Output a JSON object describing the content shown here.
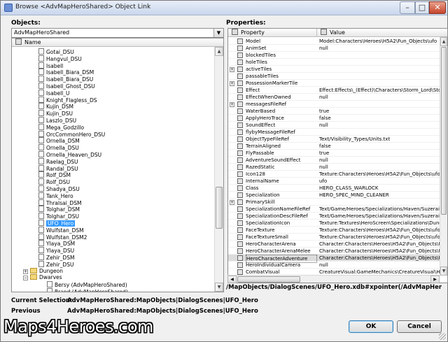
{
  "window": {
    "title": "Browse <AdvMapHeroShared> Object Link",
    "controls": {
      "minimize": "–",
      "maximize": "□",
      "close": "✕"
    }
  },
  "objects": {
    "label": "Objects:",
    "combo_value": "AdvMapHeroShared",
    "column_header": "Name",
    "items": [
      {
        "label": "Gotai_DSU",
        "type": "file"
      },
      {
        "label": "Hangvul_DSU",
        "type": "file"
      },
      {
        "label": "Isabell",
        "type": "file"
      },
      {
        "label": "Isabell_Biara_DSM",
        "type": "file"
      },
      {
        "label": "Isabell_Biara_DSU",
        "type": "file"
      },
      {
        "label": "Isabell_Ghost_DSU",
        "type": "file"
      },
      {
        "label": "Isabell_U",
        "type": "file"
      },
      {
        "label": "Knight_Flagless_DS",
        "type": "file"
      },
      {
        "label": "Kujin_DSM",
        "type": "file"
      },
      {
        "label": "Kujin_DSU",
        "type": "file"
      },
      {
        "label": "Laszlo_DSU",
        "type": "file"
      },
      {
        "label": "Mega_Godzillo",
        "type": "file"
      },
      {
        "label": "OrcCommonHero_DSU",
        "type": "file"
      },
      {
        "label": "Ornella_DSM",
        "type": "file"
      },
      {
        "label": "Ornella_DSU",
        "type": "file"
      },
      {
        "label": "Ornella_Heaven_DSU",
        "type": "file"
      },
      {
        "label": "Raelag_DSU",
        "type": "file"
      },
      {
        "label": "Randal_DSU",
        "type": "file"
      },
      {
        "label": "Rolf_DSM",
        "type": "file"
      },
      {
        "label": "Rolf_DSU",
        "type": "file"
      },
      {
        "label": "Shadya_DSU",
        "type": "file"
      },
      {
        "label": "Tank_Hero",
        "type": "file"
      },
      {
        "label": "Thralsai_DSM",
        "type": "file"
      },
      {
        "label": "Tolghar_DSM",
        "type": "file"
      },
      {
        "label": "Tolghar_DSU",
        "type": "file"
      },
      {
        "label": "UFO_Hero",
        "type": "file",
        "selected": true
      },
      {
        "label": "Wulfstan_DSM",
        "type": "file"
      },
      {
        "label": "Wulfstan_DSM2",
        "type": "file"
      },
      {
        "label": "Ylaya_DSM",
        "type": "file"
      },
      {
        "label": "Ylaya_DSU",
        "type": "file"
      },
      {
        "label": "Zehir_DSM",
        "type": "file"
      },
      {
        "label": "Zehir_DSU",
        "type": "file"
      },
      {
        "label": "Dungeon",
        "type": "folder",
        "expander": "+"
      },
      {
        "label": "Dwarves",
        "type": "folder",
        "expander": "−"
      },
      {
        "label": "Bersy (AdvMapHeroShared)",
        "type": "file"
      },
      {
        "label": "Brand (AdvMapHeroShared)",
        "type": "file"
      }
    ]
  },
  "properties": {
    "label": "Properties:",
    "col_property": "Property",
    "col_value": "Value",
    "rows": [
      {
        "name": "Model",
        "value": "Model:Characters\\Heroes\\H5A2\\Fun_Objects\\ufo",
        "exp": ""
      },
      {
        "name": "AnimSet",
        "value": "null",
        "exp": ""
      },
      {
        "name": "blockedTiles",
        "value": "",
        "exp": ""
      },
      {
        "name": "holeTiles",
        "value": "",
        "exp": ""
      },
      {
        "name": "activeTiles",
        "value": "",
        "exp": "+"
      },
      {
        "name": "passableTiles",
        "value": "",
        "exp": ""
      },
      {
        "name": "PossessionMarkerTile",
        "value": "",
        "exp": "+"
      },
      {
        "name": "Effect",
        "value": "Effect:Effects\\_(Effect)\\Characters\\Storm_Lord\\Storm_L",
        "exp": ""
      },
      {
        "name": "EffectWhenOwned",
        "value": "null",
        "exp": ""
      },
      {
        "name": "messagesFileRef",
        "value": "",
        "exp": "+"
      },
      {
        "name": "WaterBased",
        "value": "true",
        "exp": ""
      },
      {
        "name": "ApplyHeroTrace",
        "value": "false",
        "exp": ""
      },
      {
        "name": "SoundEffect",
        "value": "null",
        "exp": ""
      },
      {
        "name": "flybyMessageFileRef",
        "value": "",
        "exp": ""
      },
      {
        "name": "ObjectTypeFileRef",
        "value": "Text/Visibility_Types/Units.txt",
        "exp": ""
      },
      {
        "name": "TerrainAligned",
        "value": "false",
        "exp": ""
      },
      {
        "name": "FlyPassable",
        "value": "true",
        "exp": ""
      },
      {
        "name": "AdventureSoundEffect",
        "value": "null",
        "exp": ""
      },
      {
        "name": "RazedStatic",
        "value": "null",
        "exp": ""
      },
      {
        "name": "Icon128",
        "value": "Texture:Characters\\Heroes\\H5A2\\Fun_Objects\\ufo_ico",
        "exp": ""
      },
      {
        "name": "InternalName",
        "value": "ufo",
        "exp": ""
      },
      {
        "name": "Class",
        "value": "HERO_CLASS_WARLOCK",
        "exp": ""
      },
      {
        "name": "Specialization",
        "value": "HERO_SPEC_MIND_CLEANER",
        "exp": ""
      },
      {
        "name": "PrimarySkill",
        "value": "",
        "exp": "+"
      },
      {
        "name": "SpecializationNameFileRef",
        "value": "Text/Game/Heroes/Specializations/Haven/Suzerain/Na",
        "exp": ""
      },
      {
        "name": "SpecializationDescFileRef",
        "value": "Text/Game/Heroes/Specializations/Haven/Suzerain/De",
        "exp": ""
      },
      {
        "name": "SpecializationIcon",
        "value": "Texture:Textures\\HeroScreen\\Specializations\\Dungeon",
        "exp": ""
      },
      {
        "name": "FaceTexture",
        "value": "Texture:Characters\\Heroes\\H5A2\\Fun_Objects\\ufo_ico",
        "exp": ""
      },
      {
        "name": "FaceTextureSmall",
        "value": "Texture:Characters\\Heroes\\H5A2\\Fun_Objects\\ufo_ico",
        "exp": ""
      },
      {
        "name": "HeroCharacterArena",
        "value": "Character:Characters\\Heroes\\H5A2\\Fun_Objects\\UFO_",
        "exp": ""
      },
      {
        "name": "HeroCharacterArenaMelee",
        "value": "Character:Characters\\Heroes\\H5A2\\Fun_Objects\\UFO_",
        "exp": ""
      },
      {
        "name": "HeroCharacterAdventure",
        "value": "Character:Characters\\Heroes\\H5A2\\Fun_Objects\\UFO_",
        "exp": "",
        "selected": true
      },
      {
        "name": "HeroIndividualCamera",
        "value": "null",
        "exp": ""
      },
      {
        "name": "CombatVisual",
        "value": "CreatureVisual:GameMechanics\\CreatureVisual\\Heroes\\",
        "exp": ""
      }
    ]
  },
  "path": "/MapObjects/DialogScenes/UFO_Hero.xdb#xpointer(/AdvMapHeroShared)",
  "current_selection": {
    "label": "Current Selection:",
    "value": "AdvMapHeroShared:MapObjects|DialogScenes|UFO_Hero"
  },
  "previous": {
    "label": "Previous",
    "value": "AdvMapHeroShared:MapObjects|DialogScenes|UFO_Hero"
  },
  "buttons": {
    "ok": "OK",
    "cancel": "Cancel"
  },
  "watermark": "Maps4Heroes.com"
}
